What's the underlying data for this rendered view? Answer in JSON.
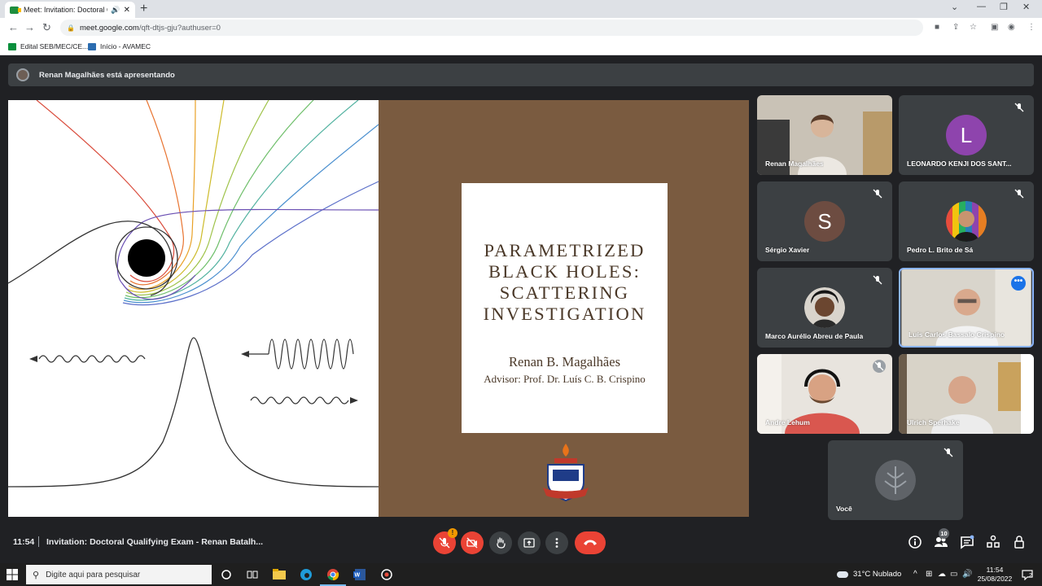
{
  "browser": {
    "tab_title": "Meet: Invitation: Doctoral Q...",
    "tab_close": "✕",
    "new_tab": "+",
    "url_host": "meet.google.com",
    "url_path": "/qft-dtjs-gju?authuser=0",
    "bookmarks": [
      {
        "label": "Edital SEB/MEC/CE...",
        "icon": "brazil-flag-icon"
      },
      {
        "label": "Início - AVAMEC",
        "icon": "avamec-icon"
      }
    ]
  },
  "meet": {
    "presenting_text": "Renan Magalhães está apresentando",
    "slide": {
      "title_lines": [
        "PARAMETRIZED",
        "BLACK HOLES:",
        "SCATTERING",
        "INVESTIGATION"
      ],
      "author": "Renan B. Magalhães",
      "advisor": "Advisor: Prof. Dr. Luís C. B. Crispino",
      "background_color": "#7a5b40"
    },
    "participants": [
      {
        "name": "Renan Magalhães",
        "muted": false,
        "video": true
      },
      {
        "name": "LEONARDO KENJI DOS SANT...",
        "muted": true,
        "video": false,
        "initial": "L",
        "color": "#8e44ad"
      },
      {
        "name": "Sérgio Xavier",
        "muted": true,
        "video": false,
        "initial": "S",
        "color": "#6d4c41"
      },
      {
        "name": "Pedro L. Brito de Sá",
        "muted": true,
        "video": false
      },
      {
        "name": "Marco Aurélio Abreu de Paula",
        "muted": true,
        "video": false
      },
      {
        "name": "Luís Carlos Bassalo Crispino",
        "muted": false,
        "video": true,
        "active": true
      },
      {
        "name": "Andre Lehum",
        "muted": true,
        "video": true
      },
      {
        "name": "Ulrich Sperhake",
        "muted": false,
        "video": true
      },
      {
        "name": "Você",
        "muted": true,
        "video": false
      }
    ],
    "bottom": {
      "time": "11:54",
      "meeting_title": "Invitation: Doctoral Qualifying Exam - Renan Batalh...",
      "mic_warning": "!",
      "people_count": "10"
    }
  },
  "taskbar": {
    "search_placeholder": "Digite aqui para pesquisar",
    "weather": "31°C  Nublado",
    "clock_time": "11:54",
    "clock_date": "25/08/2022",
    "notifications": "2"
  }
}
